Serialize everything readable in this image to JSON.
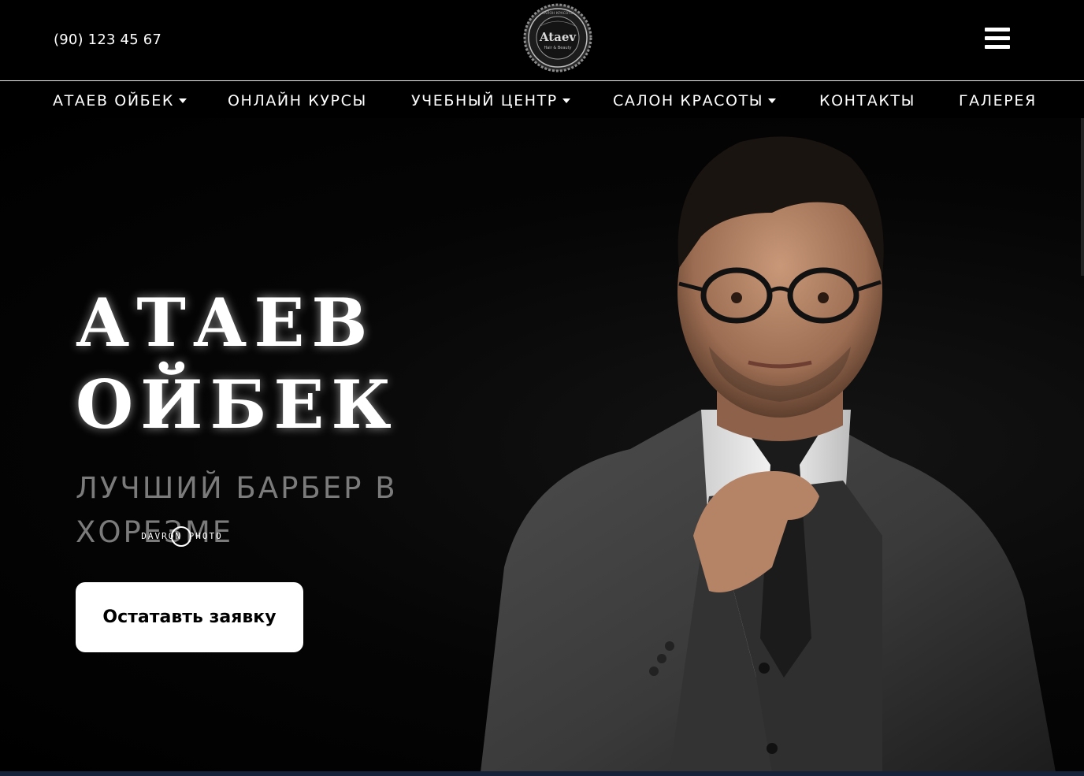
{
  "header": {
    "phone": "(90) 123 45 67",
    "logo": {
      "name": "Ataev",
      "tagline": "Hair & Beauty",
      "ring_text": "САЛОН КРАСОТЫ"
    },
    "menu_icon": "hamburger-icon"
  },
  "nav": {
    "items": [
      {
        "label": "АТАЕВ ОЙБЕК",
        "dropdown": true
      },
      {
        "label": "ОНЛАЙН КУРСЫ",
        "dropdown": false
      },
      {
        "label": "УЧЕБНЫЙ ЦЕНТР",
        "dropdown": true
      },
      {
        "label": "САЛОН КРАСОТЫ",
        "dropdown": true
      },
      {
        "label": "КОНТАКТЫ",
        "dropdown": false
      },
      {
        "label": "ГАЛЕРЕЯ",
        "dropdown": false
      }
    ]
  },
  "hero": {
    "title_line1": "АТАЕВ",
    "title_line2": "ОЙБЕК",
    "subtitle": "ЛУЧШИЙ БАРБЕР В ХОРЕЗМЕ",
    "photo_watermark": "DAVRON PHOTO",
    "cta_label": "Остатавть заявку"
  },
  "colors": {
    "background": "#000000",
    "text": "#ffffff",
    "subtitle": "#7b7b7b",
    "button_bg": "#ffffff",
    "button_text": "#000000"
  }
}
